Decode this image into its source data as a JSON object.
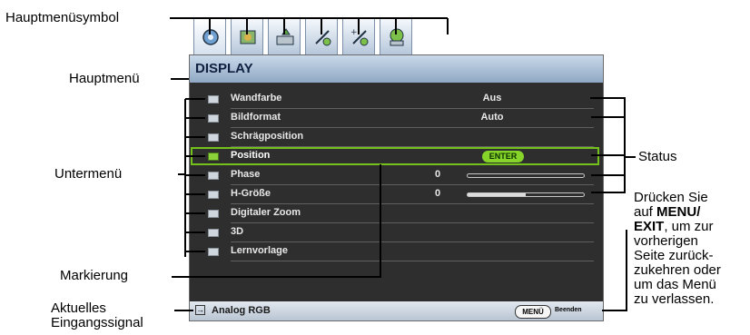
{
  "callouts": {
    "main_menu_icon": "Hauptmenüsymbol",
    "main_menu": "Hauptmenü",
    "submenu": "Untermenü",
    "status": "Status",
    "highlight": "Markierung",
    "current_input_line1": "Aktuelles",
    "current_input_line2": "Eingangssignal",
    "exit_note": [
      "Drücken Sie",
      "auf ",
      "MENU/",
      "EXIT",
      ", um zur",
      "vorherigen",
      "Seite zurück-",
      "zukehren oder",
      "um das Menü",
      "zu verlassen."
    ]
  },
  "osd": {
    "title": "DISPLAY",
    "tabs": [
      {
        "icon": "display-menu-icon"
      },
      {
        "icon": "picture-menu-icon"
      },
      {
        "icon": "source-menu-icon"
      },
      {
        "icon": "system-setup-basic-icon"
      },
      {
        "icon": "system-setup-advanced-icon"
      },
      {
        "icon": "information-menu-icon"
      }
    ],
    "items": [
      {
        "label": "Wandfarbe",
        "value": "Aus"
      },
      {
        "label": "Bildformat",
        "value": "Auto"
      },
      {
        "label": "Schrägposition",
        "value": ""
      },
      {
        "label": "Position",
        "value": "ENTER"
      },
      {
        "label": "Phase",
        "value": "0",
        "level": 0
      },
      {
        "label": "H-Größe",
        "value": "0",
        "level": 0.5
      },
      {
        "label": "Digitaler Zoom",
        "value": ""
      },
      {
        "label": "3D",
        "value": ""
      },
      {
        "label": "Lernvorlage",
        "value": ""
      }
    ],
    "footer": {
      "source": "Analog RGB",
      "menu_button": "MENÜ",
      "exit_label": "Beenden"
    }
  }
}
